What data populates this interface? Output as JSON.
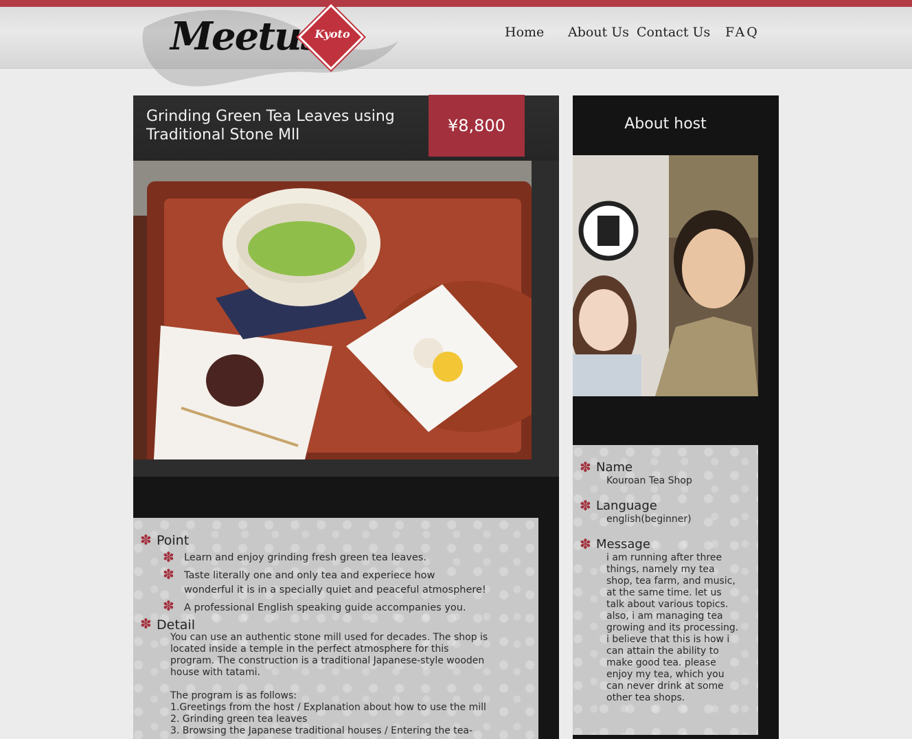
{
  "header": {
    "logo_main": "Meetus",
    "logo_badge": "Kyoto",
    "nav": [
      "Home",
      "About Us",
      "Contact Us",
      "FAQ"
    ]
  },
  "listing": {
    "title": "Grinding Green Tea Leaves using Traditional Stone Mll",
    "price": "¥8,800",
    "point_heading": "Point",
    "points": [
      "Learn and enjoy grinding fresh green tea leaves.",
      "Taste literally one and only tea and experiece how wonderful it is in a specially quiet and peaceful atmosphere!",
      "A professional English speaking guide accompanies you."
    ],
    "detail_heading": "Detail",
    "detail_text": "You can use an authentic stone mill used for decades. The shop is located inside a temple in the perfect atmosphere for this program. The construction is a traditional Japanese-style wooden house with tatami.\n\nThe program is as follows:\n1.Greetings from the host / Explanation about how to use the mill\n2. Grinding green tea leaves\n3. Browsing the Japanese traditional houses / Entering the tea-"
  },
  "host": {
    "heading": "About host",
    "name_label": "Name",
    "name_value": "Kouroan Tea Shop",
    "language_label": "Language",
    "language_value": "english(beginner)",
    "message_label": "Message",
    "message_value": "i am running after three things, namely my tea shop, tea farm, and music, at the same time. let us talk about various topics. also, i am managing tea growing and its processing. i believe that this is how i can attain the ability to make good tea. please enjoy my tea, which you can never drink at some other tea shops."
  },
  "colors": {
    "accent": "#a3303d",
    "topbar": "#b23a45",
    "panel": "#151515"
  }
}
